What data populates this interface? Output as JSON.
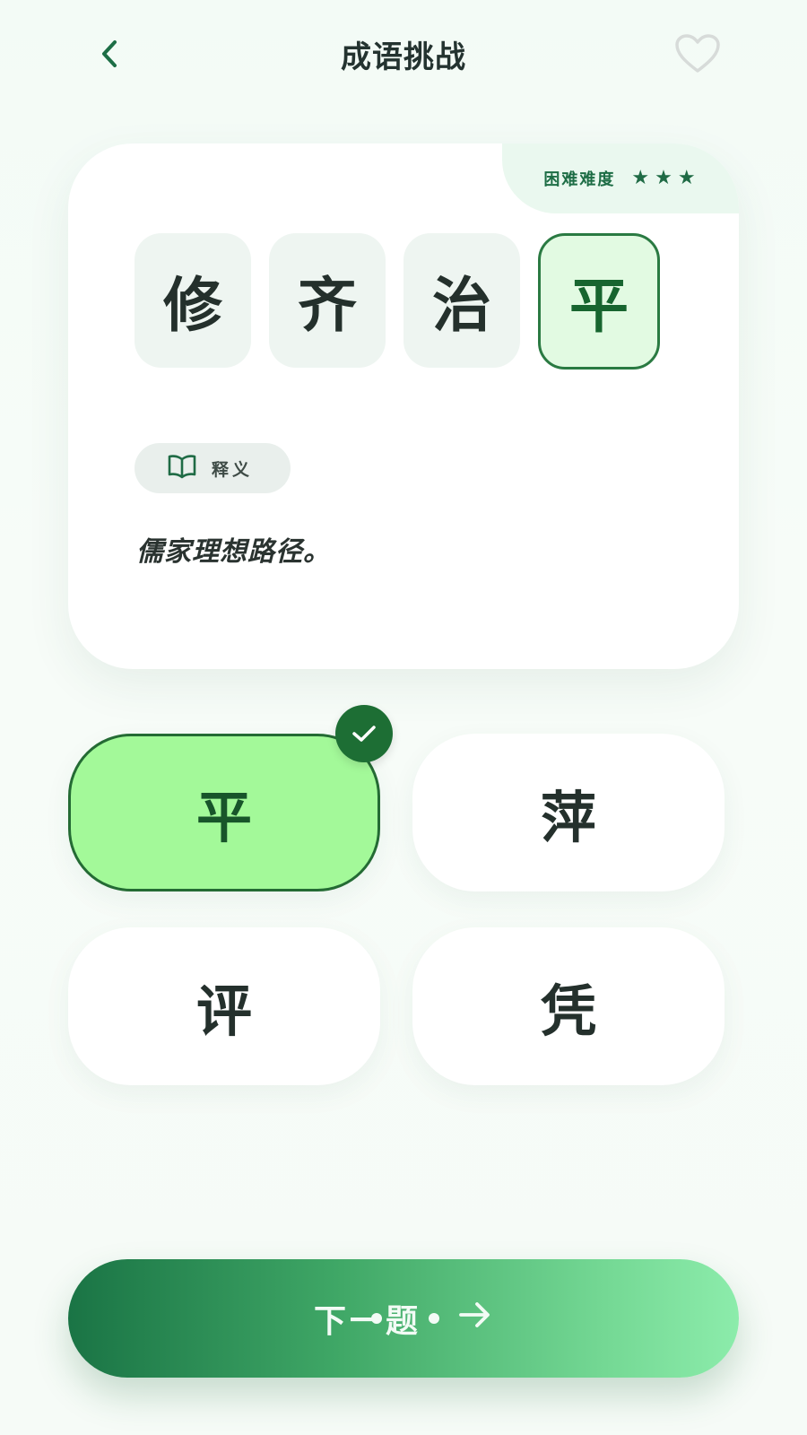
{
  "header": {
    "title": "成语挑战",
    "back_icon": "chevron-left-icon",
    "favorite_icon": "heart-outline-icon"
  },
  "question": {
    "difficulty_label": "困难难度",
    "difficulty_stars": 3,
    "star_char": "★",
    "characters": [
      "修",
      "齐",
      "治",
      "平"
    ],
    "meaning_label": "释义",
    "meaning_icon": "book-icon",
    "meaning_text": "儒家理想路径。"
  },
  "options": [
    {
      "text": "平",
      "selected": true
    },
    {
      "text": "萍",
      "selected": false
    },
    {
      "text": "评",
      "selected": false
    },
    {
      "text": "凭",
      "selected": false
    }
  ],
  "next_button": {
    "label": "下一题",
    "arrow_icon": "arrow-right-icon"
  },
  "colors": {
    "accent": "#1d6e34",
    "selected_fill": "#a3f999",
    "button_start": "#1a7445",
    "button_end": "#8cecab"
  }
}
